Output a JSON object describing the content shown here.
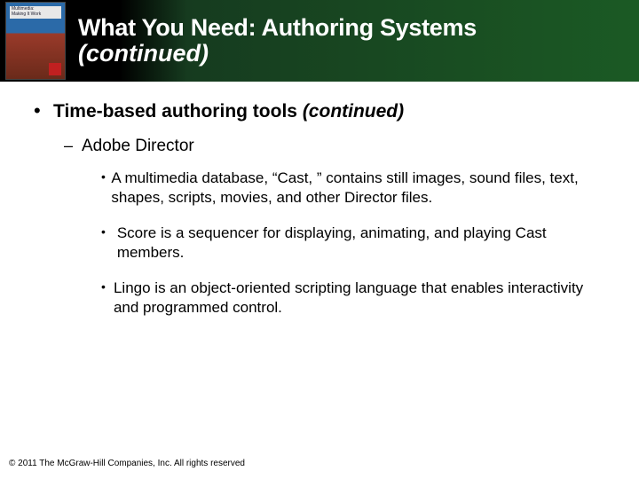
{
  "cover": {
    "line1": "Multimedia:",
    "line2": "Making It Work"
  },
  "header": {
    "title": "What You Need: Authoring Systems",
    "subtitle": "(continued)"
  },
  "bullets": {
    "lvl1_text": "Time-based authoring tools ",
    "lvl1_cont": "(continued)",
    "lvl2_text": "Adobe Director",
    "lvl3": [
      "A multimedia database, “Cast, ” contains still images, sound files, text, shapes, scripts, movies, and other Director files.",
      "Score is a sequencer for displaying, animating, and playing Cast members.",
      "Lingo is an object-oriented scripting language that enables interactivity and programmed control."
    ]
  },
  "footer": "© 2011 The McGraw-Hill Companies, Inc. All rights reserved"
}
